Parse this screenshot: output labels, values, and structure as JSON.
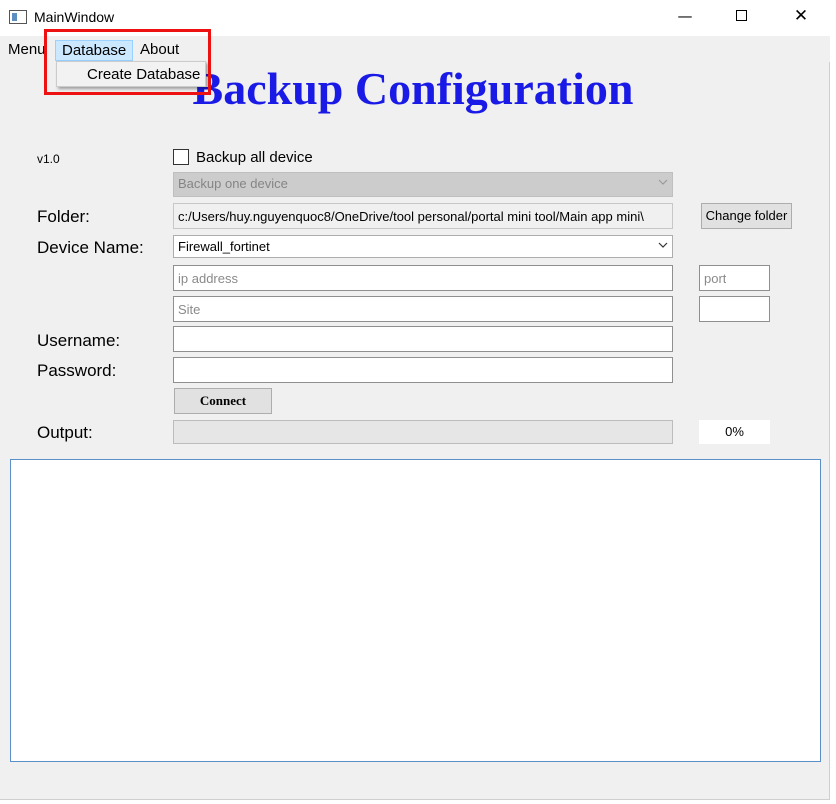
{
  "window": {
    "title": "MainWindow",
    "controls": {
      "minimize": "—",
      "close": "✕"
    }
  },
  "menubar": {
    "items": [
      "Menu",
      "Database",
      "About"
    ],
    "open_menu": {
      "items": [
        "Create Database"
      ]
    }
  },
  "header": {
    "title": "Backup Configuration",
    "version": "v1.0"
  },
  "form": {
    "backup_all_label": "Backup all device",
    "backup_all_checked": false,
    "backup_one_combo": "Backup one device",
    "folder_label": "Folder:",
    "folder_path": "c:/Users/huy.nguyenquoc8/OneDrive/tool personal/portal mini tool/Main app mini\\",
    "change_folder_button": "Change folder",
    "device_name_label": "Device Name:",
    "device_name_value": "Firewall_fortinet",
    "ip_placeholder": "ip address",
    "port_placeholder": "port",
    "site_placeholder": "Site",
    "username_label": "Username:",
    "password_label": "Password:",
    "connect_button": "Connect",
    "output_label": "Output:",
    "progress_percent": "0%",
    "progress_value": 0
  },
  "colors": {
    "title_blue": "#1a1ae6",
    "highlight_red": "#ee1111",
    "menu_selected_bg": "#cce8ff"
  }
}
